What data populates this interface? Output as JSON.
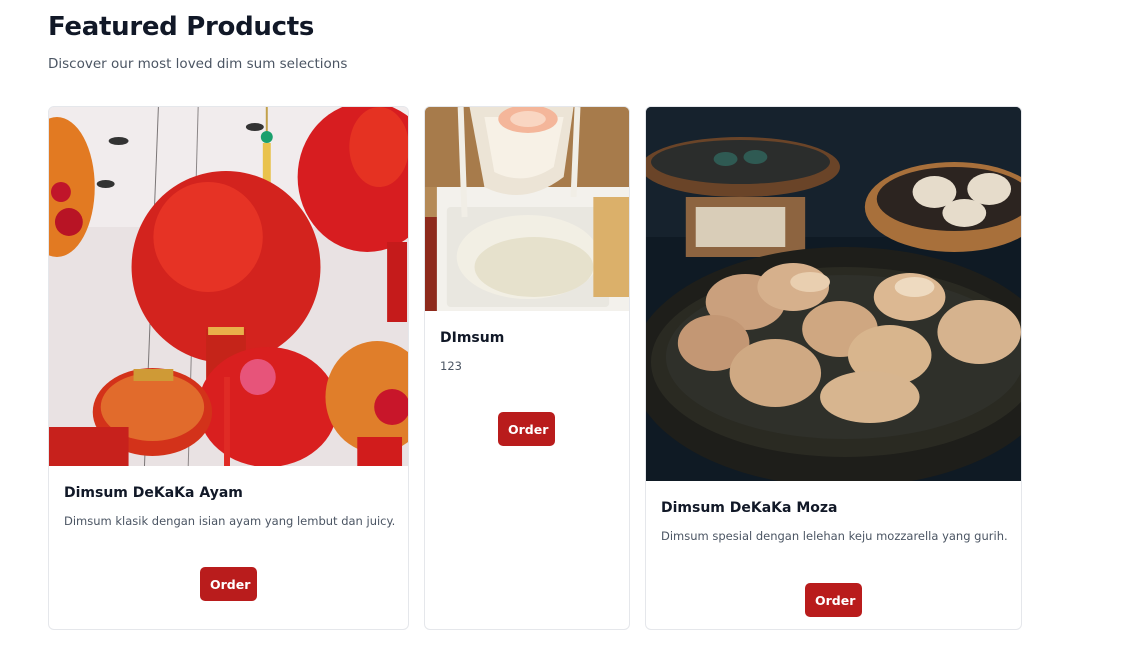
{
  "header": {
    "title": "Featured Products",
    "subtitle": "Discover our most loved dim sum selections"
  },
  "products": [
    {
      "name": "Dimsum DeKaKa Ayam",
      "description": "Dimsum klasik dengan isian ayam yang lembut dan juicy.",
      "button_label": "Order",
      "image_alt": "red lanterns"
    },
    {
      "name": "DImsum",
      "description": "123",
      "button_label": "Order",
      "image_alt": "dim sum with dipping sauce"
    },
    {
      "name": "Dimsum DeKaKa Moza",
      "description": "Dimsum spesial dengan lelehan keju mozzarella yang gurih.",
      "button_label": "Order",
      "image_alt": "dumplings in steamer"
    }
  ],
  "colors": {
    "accent": "#b91c1c",
    "title": "#111827",
    "muted": "#4b5563",
    "border": "#e5e7eb"
  }
}
